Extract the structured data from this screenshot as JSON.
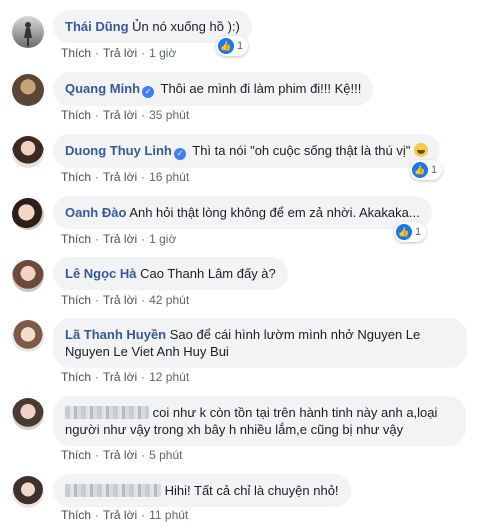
{
  "labels": {
    "like": "Thích",
    "reply": "Trả lời",
    "dot": "·"
  },
  "comments": [
    {
      "author": "Thái Dũng",
      "text": "Ủn nó xuống hồ ):)",
      "time": "1 giờ",
      "reactions": "1"
    },
    {
      "author": "Quang Minh",
      "text": "Thôi ae mình đi làm phim đi!!! Kệ!!!",
      "time": "35 phút"
    },
    {
      "author": "Duong Thuy Linh",
      "text": "Thì ta nói \"oh cuộc sống thật là thú vị\"",
      "time": "16 phút",
      "reactions": "1"
    },
    {
      "author": "Oanh Đào",
      "text": "Anh hỏi thật lòng không để em zả nhời. Akakaka...",
      "time": "1 giờ",
      "reactions": "1"
    },
    {
      "author": "Lê Ngọc Hà",
      "text": "Cao Thanh Lâm đấy à?",
      "time": "42 phút"
    },
    {
      "author": "Lã Thanh Huyền",
      "text_line1": "Sao để cái hình lườm mình nhở Nguyen Le",
      "text_line2": "Nguyen Le Viet Anh Huy Bui",
      "time": "12 phút"
    },
    {
      "author": "",
      "text_line1": "coi như k còn tồn tại trên hành tinh này anh a,loại",
      "text_line2": "người như vậy trong xh bây h nhiều lắm,e cũng bị như vậy",
      "time": "5 phút"
    },
    {
      "author": "",
      "text": "Hihi! Tất cả chỉ là chuyện nhỏ!",
      "time": "11 phút"
    }
  ],
  "colors": {
    "author": "#385898",
    "bubble": "#f2f3f5",
    "like_blue": "#1877f2",
    "meta": "#606770"
  },
  "icons": {
    "verified": "verified-badge-icon",
    "like": "like-reaction-icon",
    "haha": "laughing-emoji-icon"
  }
}
